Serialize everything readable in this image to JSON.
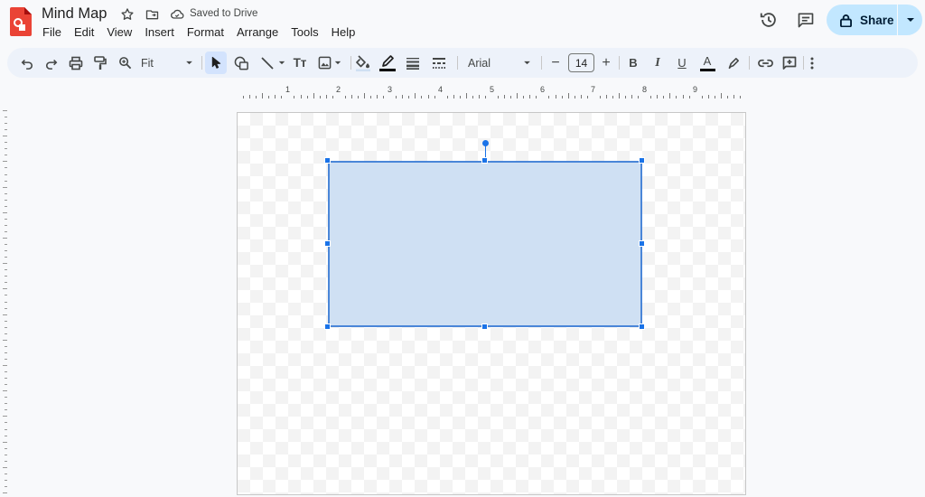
{
  "header": {
    "doc_title": "Mind Map",
    "save_status": "Saved to Drive",
    "menu": [
      "File",
      "Edit",
      "View",
      "Insert",
      "Format",
      "Arrange",
      "Tools",
      "Help"
    ],
    "share_label": "Share"
  },
  "toolbar": {
    "zoom": "Fit",
    "font": "Arial",
    "font_size": "14",
    "minus": "−",
    "plus": "+",
    "bold": "B",
    "italic": "I",
    "underline": "U",
    "text_color_glyph": "A",
    "textbox_glyph": "Tт"
  },
  "ruler": {
    "labels": [
      "1",
      "2",
      "3",
      "4",
      "5",
      "6",
      "7",
      "8",
      "9"
    ]
  },
  "colors": {
    "accent": "#1a73e8",
    "shape_fill": "#cfe0f3",
    "shape_border": "#4a86d8",
    "share_bg": "#c2e7ff",
    "toolbar_bg": "#edf2fa"
  }
}
